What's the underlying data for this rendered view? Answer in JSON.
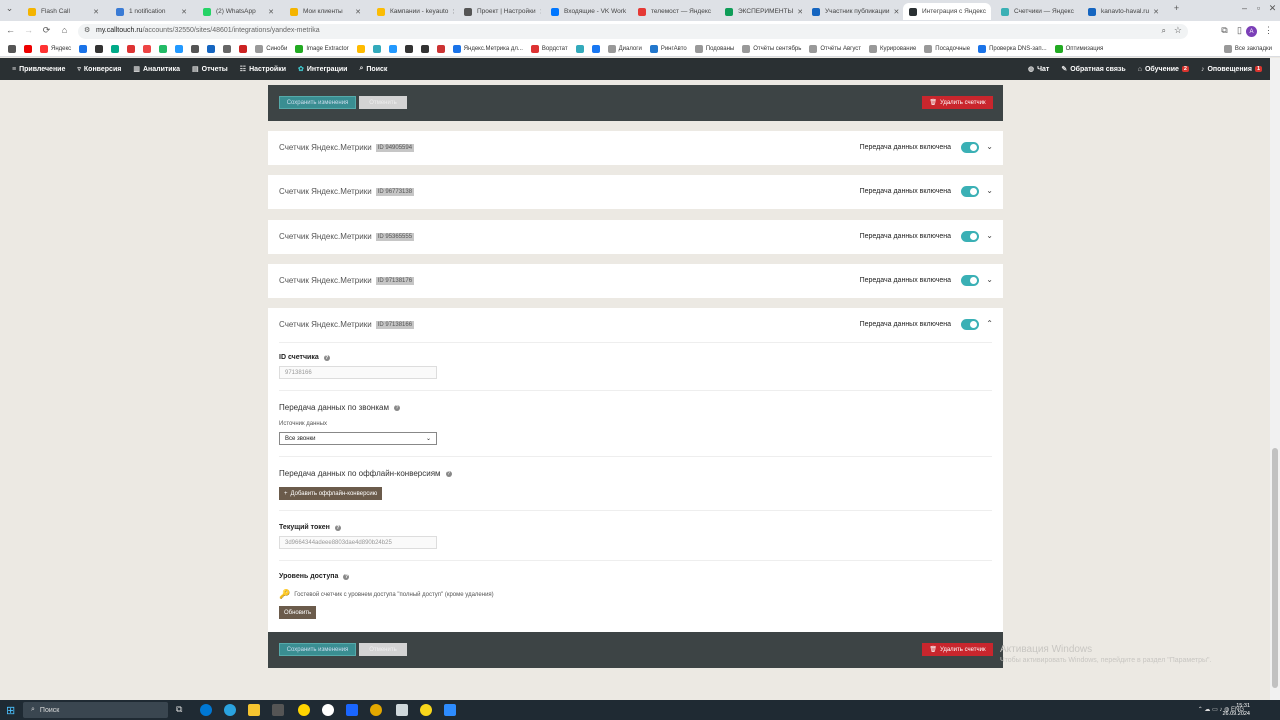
{
  "browser": {
    "tabs": [
      {
        "label": "Flash Call",
        "color": "#f4b400"
      },
      {
        "label": "1 notification",
        "color": "#3a7bd5"
      },
      {
        "label": "(2) WhatsApp",
        "color": "#25d366"
      },
      {
        "label": "Мои клиенты",
        "color": "#f4b400"
      },
      {
        "label": "Кампании - keyauto",
        "color": "#fbbc04"
      },
      {
        "label": "Проект | Настройки",
        "color": "#555555"
      },
      {
        "label": "Входящие - VK Work",
        "color": "#0077ff"
      },
      {
        "label": "телемост — Яндекс",
        "color": "#e53935"
      },
      {
        "label": "ЭКСПЕРИМЕНТЫ",
        "color": "#0f9d58"
      },
      {
        "label": "Участник публикации",
        "color": "#1565c0"
      },
      {
        "label": "Интеграция с Яндекс",
        "color": "#2a3033"
      },
      {
        "label": "Счетчики — Яндекс",
        "color": "#3ab0b5"
      },
      {
        "label": "kanavto-haval.ru",
        "color": "#1565c0"
      }
    ],
    "url_host": "my.calltouch.ru",
    "url_path": "/accounts/32550/sites/48601/integrations/yandex-metrika",
    "bookmarks": [
      "Яндекс",
      "Синоби",
      "Image Extractor",
      "Яндекс.Метрика дл...",
      "Вордстат",
      "Диалоги",
      "РингАвто",
      "Подованы",
      "Отчёты сентябрь",
      "Отчёты Август",
      "Курирование",
      "Посадочные",
      "Проверка DNS-зап...",
      "Оптимизация",
      "Все закладки"
    ]
  },
  "appnav": {
    "items": [
      "Привлечение",
      "Конверсия",
      "Аналитика",
      "Отчеты",
      "Настройки",
      "Интеграции",
      "Поиск"
    ],
    "right": {
      "chat": "Чат",
      "feedback": "Обратная связь",
      "learning": "Обучение",
      "learning_badge": "2",
      "alerts": "Оповещения",
      "alerts_badge": "1"
    }
  },
  "actions": {
    "save": "Сохранить изменения",
    "cancel": "Отменить",
    "delete": "Удалить счетчик"
  },
  "counter_title": "Счетчик Яндекс.Метрики",
  "transfer_on": "Передача данных включена",
  "counters": [
    {
      "id": "ID 94905594"
    },
    {
      "id": "ID 96773138"
    },
    {
      "id": "ID 95365555"
    },
    {
      "id": "ID 97138176"
    },
    {
      "id": "ID 97138166"
    }
  ],
  "details": {
    "counter_id_label": "ID счетчика",
    "counter_id_value": "97138166",
    "calls_section": "Передача данных по звонкам",
    "source_label": "Источник данных",
    "source_value": "Все звонки",
    "offline_section": "Передача данных по оффлайн-конверсиям",
    "add_offline": "Добавить оффлайн-конверсию",
    "token_label": "Текущий токен",
    "token_value": "3d9664344adeee8803dae4d890b24b25",
    "access_label": "Уровень доступа",
    "access_text": "Гостевой счетчик с уровнем доступа \"полный доступ\" (кроме удаления)",
    "refresh": "Обновить"
  },
  "watermark": {
    "title": "Активация Windows",
    "sub": "Чтобы активировать Windows, перейдите в раздел \"Параметры\"."
  },
  "taskbar": {
    "search": "Поиск",
    "lang": "ENG",
    "time": "15:31",
    "date": "26.09.2024"
  }
}
